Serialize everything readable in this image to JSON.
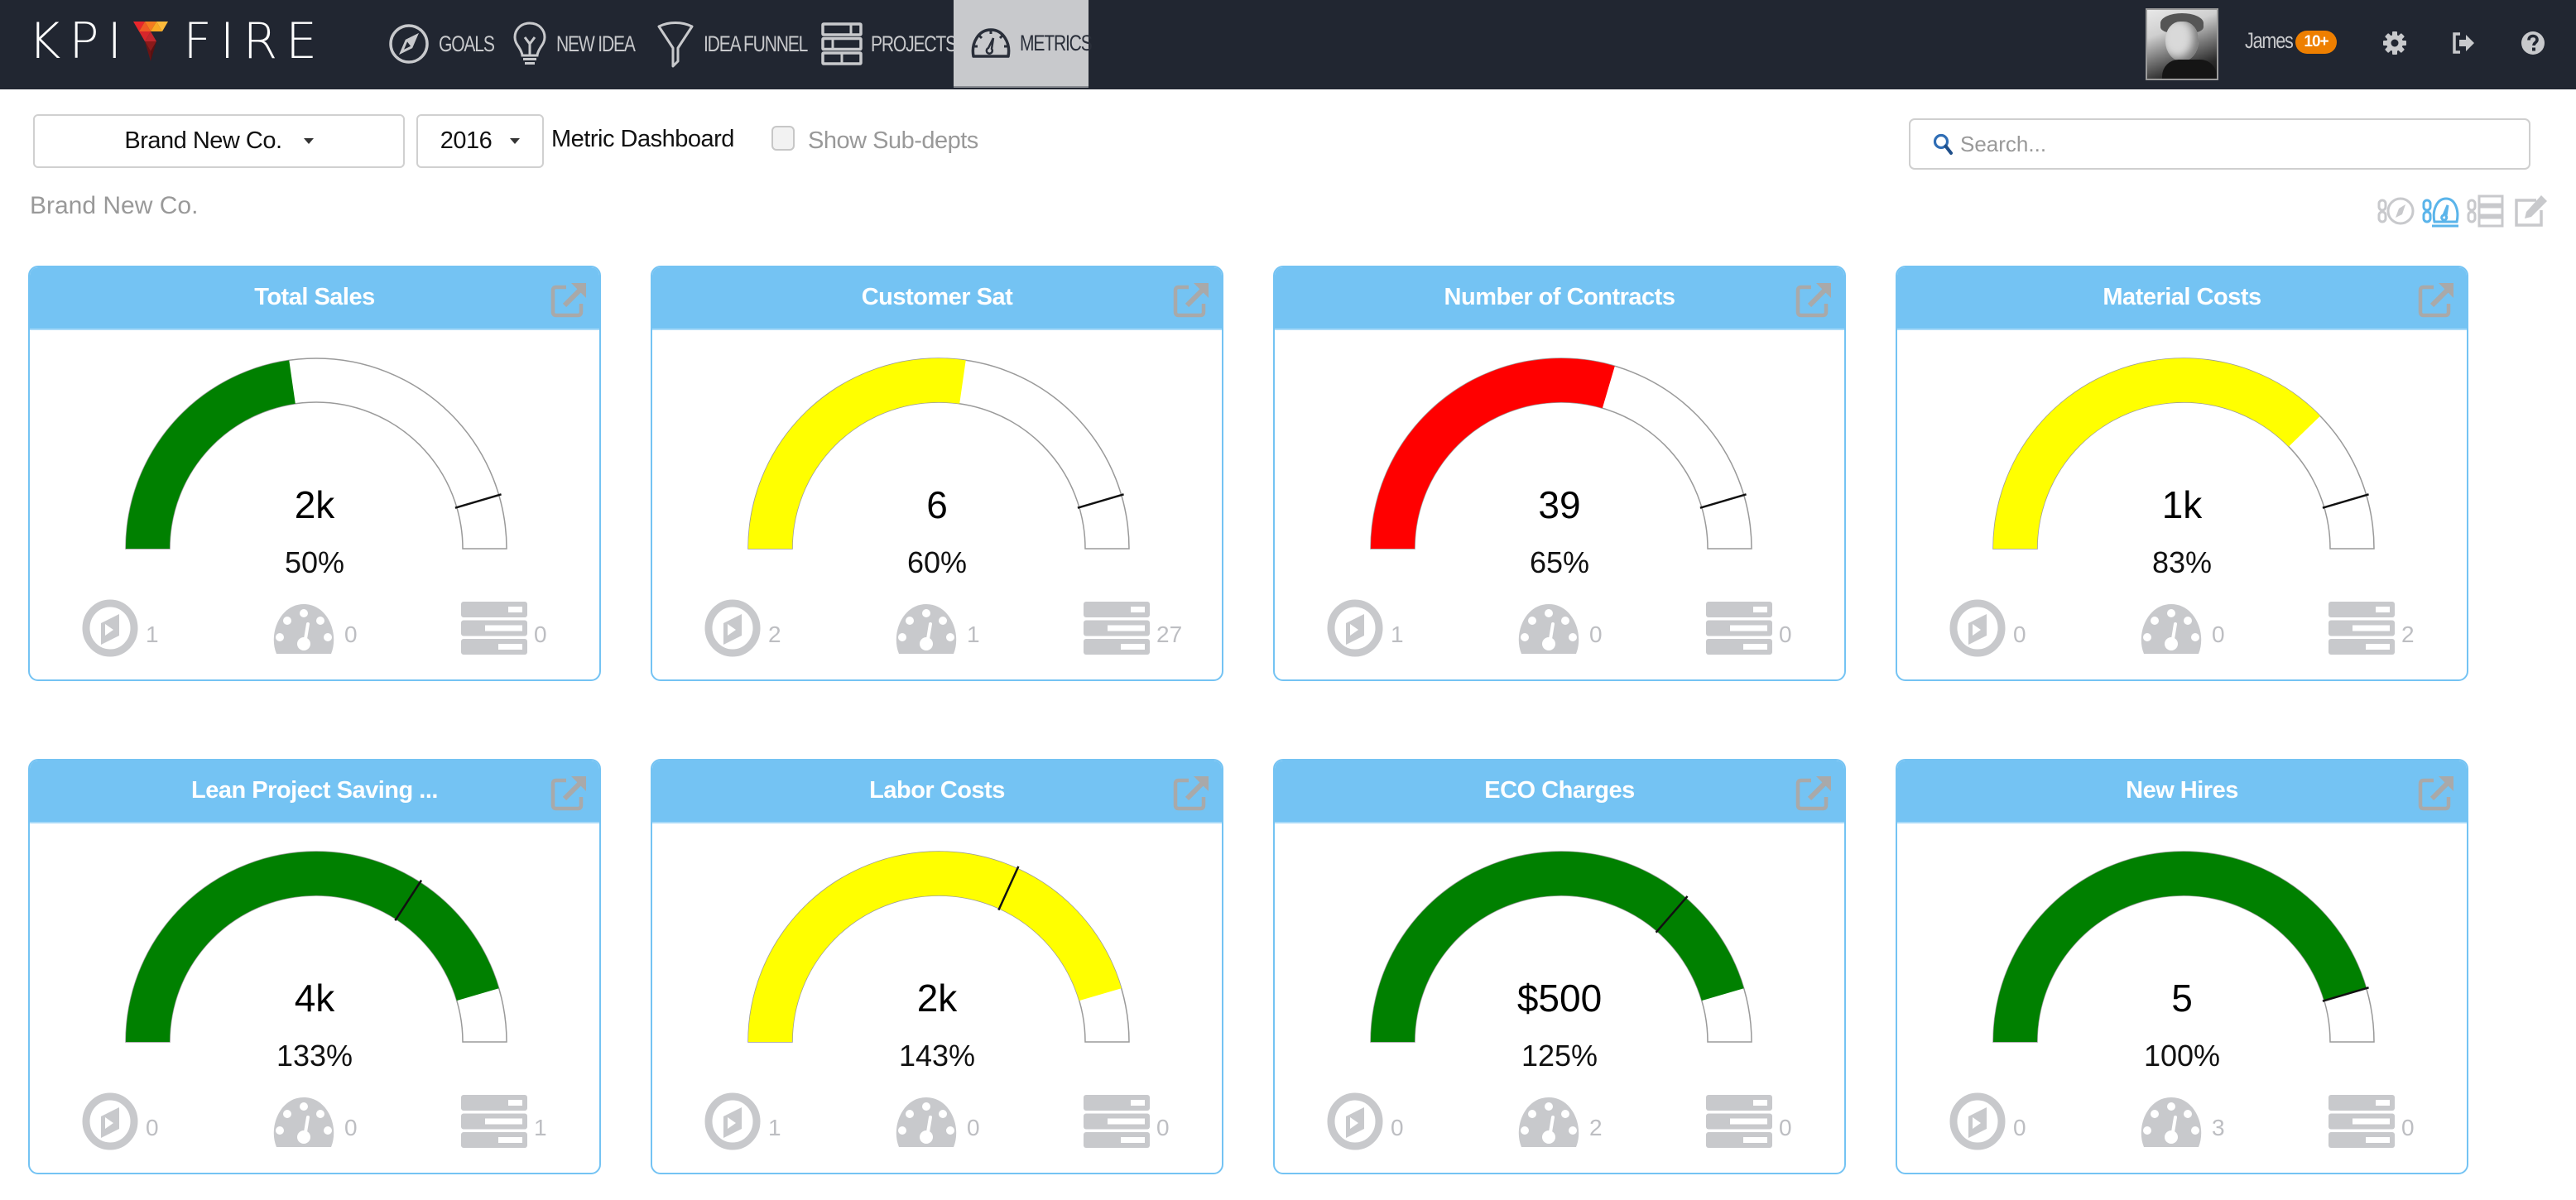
{
  "app": {
    "logo_left": "KPI",
    "logo_right": "FIRE"
  },
  "nav": {
    "items": [
      {
        "key": "goals",
        "label": "GOALS",
        "icon": "compass-icon"
      },
      {
        "key": "new_idea",
        "label": "NEW IDEA",
        "icon": "lightbulb-icon"
      },
      {
        "key": "idea_funnel",
        "label": "IDEA FUNNEL",
        "icon": "funnel-icon"
      },
      {
        "key": "projects",
        "label": "PROJECTS",
        "icon": "projects-icon"
      },
      {
        "key": "metrics",
        "label": "METRICS",
        "icon": "speedometer-icon",
        "active": true
      }
    ],
    "user": {
      "name": "James",
      "notifications": "10+"
    },
    "actions": {
      "settings_icon": "gear-icon",
      "signout_icon": "sign-out-icon",
      "help_icon": "question-circle-icon"
    }
  },
  "toolbar": {
    "department": "Brand New Co.",
    "year": "2016",
    "dashboard_title": "Metric Dashboard",
    "show_subdepts_label": "Show Sub-depts",
    "show_subdepts_checked": false,
    "breadcrumb": "Brand New Co.",
    "search_placeholder": "Search...",
    "search_value": "",
    "view_icons": [
      {
        "name": "linked-goals-view-icon",
        "active": false
      },
      {
        "name": "linked-metrics-view-icon",
        "active": true
      },
      {
        "name": "linked-projects-view-icon",
        "active": false
      },
      {
        "name": "edit-icon",
        "active": false
      }
    ]
  },
  "colors": {
    "navbar": "#212631",
    "nav_text": "#c8c9cc",
    "card_header": "#74c3f3",
    "badge": "#ee7f00",
    "status_green": "#008000",
    "status_yellow": "#ffff00",
    "status_red": "#ff0000",
    "footer_icon": "#c8c9cc",
    "active_view_icon": "#5ab4ea"
  },
  "cards": [
    {
      "title": "Total Sales",
      "value": "2k",
      "percent_label": "50%",
      "percent": 50,
      "status": "green",
      "goals": "1",
      "metrics": "0",
      "projects": "0"
    },
    {
      "title": "Customer Sat",
      "value": "6",
      "percent_label": "60%",
      "percent": 60,
      "status": "yellow",
      "goals": "2",
      "metrics": "1",
      "projects": "27"
    },
    {
      "title": "Number of Contracts",
      "value": "39",
      "percent_label": "65%",
      "percent": 65,
      "status": "red",
      "goals": "1",
      "metrics": "0",
      "projects": "0"
    },
    {
      "title": "Material Costs",
      "value": "1k",
      "percent_label": "83%",
      "percent": 83,
      "status": "yellow",
      "goals": "0",
      "metrics": "0",
      "projects": "2"
    },
    {
      "title": "Lean Project Saving ...",
      "value": "4k",
      "percent_label": "133%",
      "percent": 133,
      "status": "green",
      "goals": "0",
      "metrics": "0",
      "projects": "1"
    },
    {
      "title": "Labor Costs",
      "value": "2k",
      "percent_label": "143%",
      "percent": 143,
      "status": "yellow",
      "goals": "1",
      "metrics": "0",
      "projects": "0"
    },
    {
      "title": "ECO Charges",
      "value": "$500",
      "percent_label": "125%",
      "percent": 125,
      "status": "green",
      "goals": "0",
      "metrics": "2",
      "projects": "0"
    },
    {
      "title": "New Hires",
      "value": "5",
      "percent_label": "100%",
      "percent": 100,
      "status": "green",
      "goals": "0",
      "metrics": "3",
      "projects": "0"
    }
  ]
}
